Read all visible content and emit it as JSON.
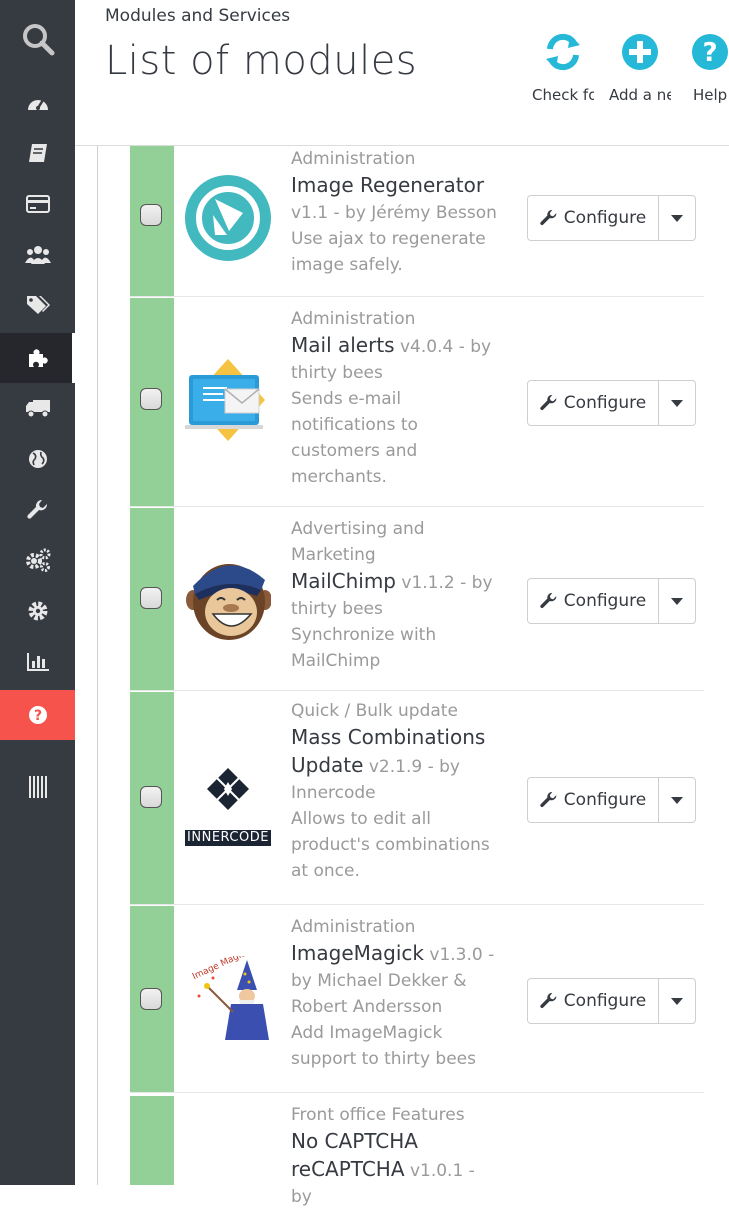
{
  "sidebar": {
    "items": [
      {
        "icon": "search-icon"
      },
      {
        "icon": "dashboard-icon"
      },
      {
        "icon": "orders-icon"
      },
      {
        "icon": "credit-card-icon"
      },
      {
        "icon": "customers-icon"
      },
      {
        "icon": "tags-icon"
      },
      {
        "icon": "puzzle-icon",
        "active": true
      },
      {
        "icon": "truck-icon"
      },
      {
        "icon": "globe-icon"
      },
      {
        "icon": "wrench-icon"
      },
      {
        "icon": "cogs-icon"
      },
      {
        "icon": "gear-icon"
      },
      {
        "icon": "bar-chart-icon"
      },
      {
        "icon": "help-icon"
      },
      {
        "icon": "barcode-icon"
      }
    ],
    "help_color": "#f5534c"
  },
  "header": {
    "breadcrumb": "Modules and Services",
    "title": "List of modules",
    "toolbar": {
      "check_label": "Check for updates",
      "add_label": "Add a new module",
      "help_label": "Help"
    },
    "accent": "#25b9d7"
  },
  "modules": [
    {
      "category": "Administration",
      "name": "Image Regenerator",
      "version": "v1.1 - by Jérémy Besson",
      "description": "Use ajax to regenerate image safely.",
      "configure_label": "Configure",
      "logo_icon": "image-regenerator-logo"
    },
    {
      "category": "Administration",
      "name": "Mail alerts",
      "version": "v4.0.4 - by thirty bees",
      "description": "Sends e-mail notifications to customers and merchants.",
      "configure_label": "Configure",
      "logo_icon": "mail-alerts-logo"
    },
    {
      "category": "Advertising and Marketing",
      "name": "MailChimp",
      "version": "v1.1.2 - by thirty bees",
      "description": "Synchronize with MailChimp",
      "configure_label": "Configure",
      "logo_icon": "mailchimp-logo"
    },
    {
      "category": "Quick / Bulk update",
      "name": "Mass Combinations Update",
      "version": "v2.1.9 - by Innercode",
      "description": "Allows to edit all product's combinations at once.",
      "configure_label": "Configure",
      "logo_icon": "innercode-logo",
      "logo_text": "INNERCODE"
    },
    {
      "category": "Administration",
      "name": "ImageMagick",
      "version": "v1.3.0 - by Michael Dekker & Robert Andersson",
      "description": "Add ImageMagick support to thirty bees",
      "configure_label": "Configure",
      "logo_icon": "imagemagick-wizard-logo",
      "logo_text": "Image Magick"
    },
    {
      "category": "Front office Features",
      "name": "No CAPTCHA reCAPTCHA",
      "version": "v1.0.1 - by",
      "description": "",
      "configure_label": "",
      "logo_icon": ""
    }
  ],
  "status_color": "#92d097"
}
